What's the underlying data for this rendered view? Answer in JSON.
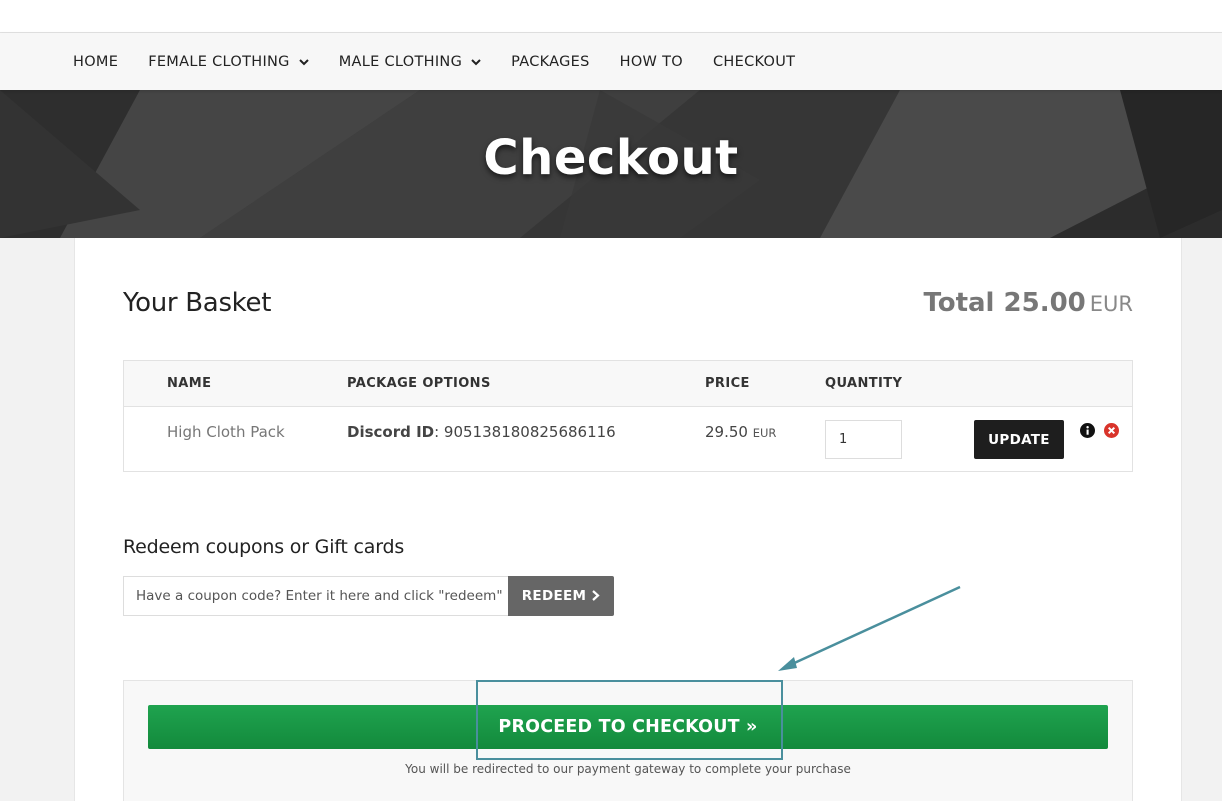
{
  "nav": {
    "items": [
      {
        "label": "HOME",
        "dropdown": false
      },
      {
        "label": "FEMALE CLOTHING",
        "dropdown": true
      },
      {
        "label": "MALE CLOTHING",
        "dropdown": true
      },
      {
        "label": "PACKAGES",
        "dropdown": false
      },
      {
        "label": "HOW TO",
        "dropdown": false
      },
      {
        "label": "CHECKOUT",
        "dropdown": false
      }
    ]
  },
  "hero": {
    "title": "Checkout"
  },
  "basket": {
    "title": "Your Basket",
    "total_label": "Total 25.00",
    "total_currency": "EUR",
    "columns": [
      "NAME",
      "PACKAGE OPTIONS",
      "PRICE",
      "QUANTITY"
    ],
    "items": [
      {
        "name": "High Cloth Pack",
        "option_key": "Discord ID",
        "option_value": ": 905138180825686116",
        "price": "29.50",
        "price_currency": "EUR",
        "quantity": "1",
        "update_label": "UPDATE"
      }
    ]
  },
  "coupon": {
    "title": "Redeem coupons or Gift cards",
    "placeholder": "Have a coupon code? Enter it here and click \"redeem\"",
    "button_label": "REDEEM"
  },
  "checkout": {
    "button_label": "PROCEED TO CHECKOUT »",
    "note": "You will be redirected to our payment gateway to complete your purchase"
  },
  "colors": {
    "proceed_green": "#1a9a48",
    "update_dark": "#1e1e1e",
    "redeem_gray": "#666666",
    "annotation_teal": "#4a8f9d",
    "remove_red": "#d9342b"
  },
  "icons": [
    "chevron-down-icon",
    "info-icon",
    "remove-icon",
    "chevron-right-icon"
  ]
}
